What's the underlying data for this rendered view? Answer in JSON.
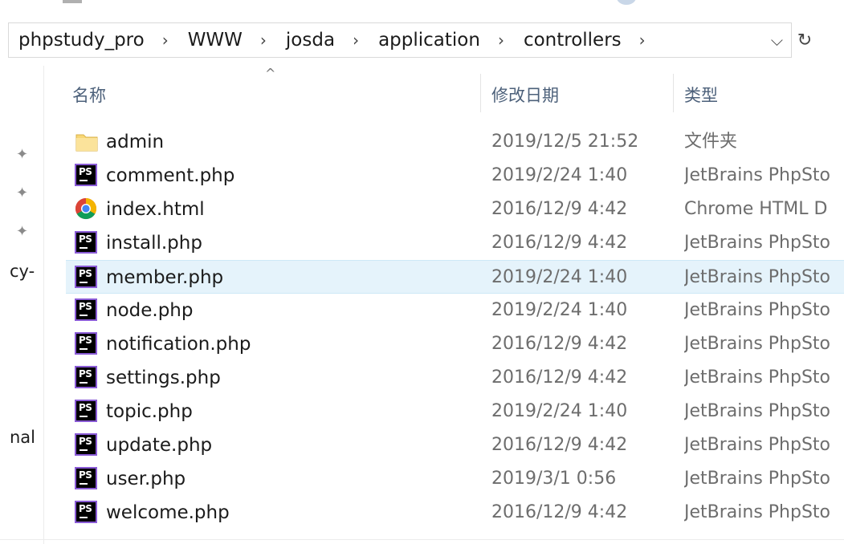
{
  "breadcrumb": [
    "phpstudy_pro",
    "WWW",
    "josda",
    "application",
    "controllers"
  ],
  "nav_fragments": [
    "cy-",
    "nal"
  ],
  "columns": {
    "name": "名称",
    "date": "修改日期",
    "type": "类型"
  },
  "files": [
    {
      "name": "admin",
      "date": "2019/12/5 21:52",
      "type": "文件夹",
      "icon": "folder-icon"
    },
    {
      "name": "comment.php",
      "date": "2019/2/24 1:40",
      "type": "JetBrains PhpSto",
      "icon": "phpstorm-file-icon"
    },
    {
      "name": "index.html",
      "date": "2016/12/9 4:42",
      "type": "Chrome HTML D",
      "icon": "chrome-file-icon"
    },
    {
      "name": "install.php",
      "date": "2016/12/9 4:42",
      "type": "JetBrains PhpSto",
      "icon": "phpstorm-file-icon"
    },
    {
      "name": "member.php",
      "date": "2019/2/24 1:40",
      "type": "JetBrains PhpSto",
      "icon": "phpstorm-file-icon",
      "selected": true
    },
    {
      "name": "node.php",
      "date": "2019/2/24 1:40",
      "type": "JetBrains PhpSto",
      "icon": "phpstorm-file-icon"
    },
    {
      "name": "notification.php",
      "date": "2016/12/9 4:42",
      "type": "JetBrains PhpSto",
      "icon": "phpstorm-file-icon"
    },
    {
      "name": "settings.php",
      "date": "2016/12/9 4:42",
      "type": "JetBrains PhpSto",
      "icon": "phpstorm-file-icon"
    },
    {
      "name": "topic.php",
      "date": "2019/2/24 1:40",
      "type": "JetBrains PhpSto",
      "icon": "phpstorm-file-icon"
    },
    {
      "name": "update.php",
      "date": "2016/12/9 4:42",
      "type": "JetBrains PhpSto",
      "icon": "phpstorm-file-icon"
    },
    {
      "name": "user.php",
      "date": "2019/3/1 0:56",
      "type": "JetBrains PhpSto",
      "icon": "phpstorm-file-icon"
    },
    {
      "name": "welcome.php",
      "date": "2016/12/9 4:42",
      "type": "JetBrains PhpSto",
      "icon": "phpstorm-file-icon"
    }
  ],
  "colors": {
    "selected_row": "#e5f3fb",
    "header_text": "#4c607a",
    "ps_border": "#8a5bd6",
    "folder": "#f8d775"
  }
}
